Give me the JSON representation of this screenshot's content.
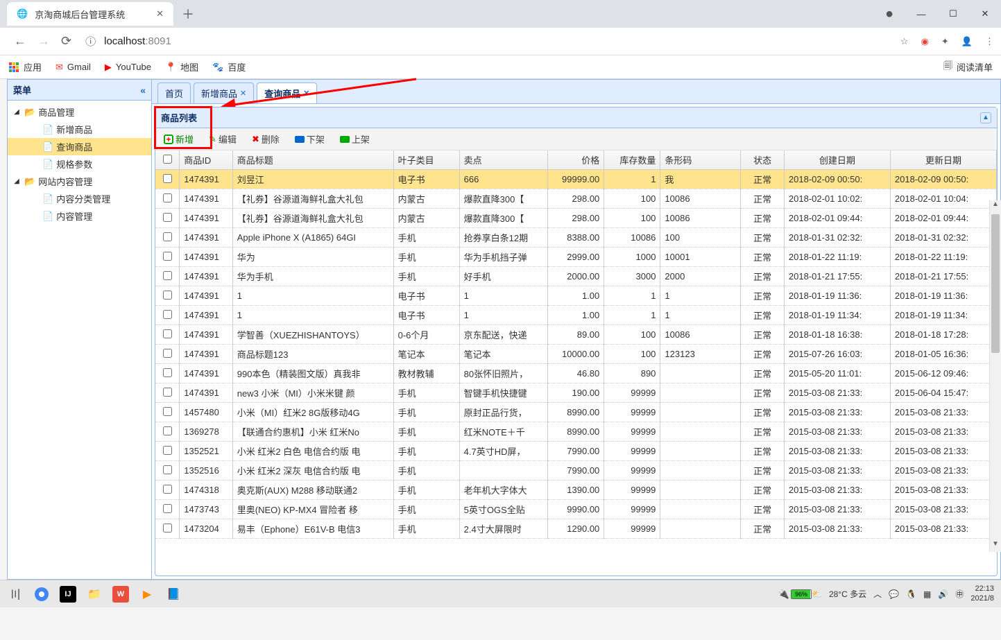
{
  "browser": {
    "tab_title": "京淘商城后台管理系统",
    "url_host": "localhost",
    "url_port": ":8091"
  },
  "bookmarks": {
    "apps": "应用",
    "gmail": "Gmail",
    "youtube": "YouTube",
    "maps": "地图",
    "baidu": "百度",
    "reading_list": "阅读清单"
  },
  "sidebar": {
    "title": "菜单",
    "items": [
      {
        "label": "商品管理",
        "type": "folder",
        "expanded": true
      },
      {
        "label": "新增商品",
        "type": "page"
      },
      {
        "label": "查询商品",
        "type": "page",
        "selected": true
      },
      {
        "label": "规格参数",
        "type": "page"
      },
      {
        "label": "网站内容管理",
        "type": "folder",
        "expanded": true
      },
      {
        "label": "内容分类管理",
        "type": "page"
      },
      {
        "label": "内容管理",
        "type": "page"
      }
    ]
  },
  "tabs": [
    {
      "label": "首页",
      "closable": false
    },
    {
      "label": "新增商品",
      "closable": true
    },
    {
      "label": "查询商品",
      "closable": true,
      "active": true
    }
  ],
  "panel": {
    "title": "商品列表"
  },
  "toolbar": {
    "add": "新增",
    "edit": "编辑",
    "delete": "删除",
    "down": "下架",
    "up": "上架"
  },
  "columns": {
    "id": "商品ID",
    "title": "商品标题",
    "category": "叶子类目",
    "sellpoint": "卖点",
    "price": "价格",
    "stock": "库存数量",
    "barcode": "条形码",
    "status": "状态",
    "created": "创建日期",
    "updated": "更新日期"
  },
  "rows": [
    {
      "id": "1474391",
      "title": "刘昱江",
      "category": "电子书",
      "sellpoint": "666",
      "price": "99999.00",
      "stock": "1",
      "barcode": "我",
      "status": "正常",
      "created": "2018-02-09 00:50:",
      "updated": "2018-02-09 00:50:",
      "selected": true
    },
    {
      "id": "1474391",
      "title": "【礼券】谷源道海鲜礼盒大礼包",
      "category": "内蒙古",
      "sellpoint": "爆款直降300【",
      "price": "298.00",
      "stock": "100",
      "barcode": "10086",
      "status": "正常",
      "created": "2018-02-01 10:02:",
      "updated": "2018-02-01 10:04:"
    },
    {
      "id": "1474391",
      "title": "【礼券】谷源道海鲜礼盒大礼包",
      "category": "内蒙古",
      "sellpoint": "爆款直降300【",
      "price": "298.00",
      "stock": "100",
      "barcode": "10086",
      "status": "正常",
      "created": "2018-02-01 09:44:",
      "updated": "2018-02-01 09:44:"
    },
    {
      "id": "1474391",
      "title": "Apple iPhone X (A1865) 64GI",
      "category": "手机",
      "sellpoint": "抢券享白条12期",
      "price": "8388.00",
      "stock": "10086",
      "barcode": "100",
      "status": "正常",
      "created": "2018-01-31 02:32:",
      "updated": "2018-01-31 02:32:"
    },
    {
      "id": "1474391",
      "title": "华为",
      "category": "手机",
      "sellpoint": "华为手机挡子弹",
      "price": "2999.00",
      "stock": "1000",
      "barcode": "10001",
      "status": "正常",
      "created": "2018-01-22 11:19:",
      "updated": "2018-01-22 11:19:"
    },
    {
      "id": "1474391",
      "title": "华为手机",
      "category": "手机",
      "sellpoint": "好手机",
      "price": "2000.00",
      "stock": "3000",
      "barcode": "2000",
      "status": "正常",
      "created": "2018-01-21 17:55:",
      "updated": "2018-01-21 17:55:"
    },
    {
      "id": "1474391",
      "title": "1",
      "category": "电子书",
      "sellpoint": "1",
      "price": "1.00",
      "stock": "1",
      "barcode": "1",
      "status": "正常",
      "created": "2018-01-19 11:36:",
      "updated": "2018-01-19 11:36:"
    },
    {
      "id": "1474391",
      "title": "1",
      "category": "电子书",
      "sellpoint": "1",
      "price": "1.00",
      "stock": "1",
      "barcode": "1",
      "status": "正常",
      "created": "2018-01-19 11:34:",
      "updated": "2018-01-19 11:34:"
    },
    {
      "id": "1474391",
      "title": "学智善（XUEZHISHANTOYS）",
      "category": "0-6个月",
      "sellpoint": "京东配送，快递",
      "price": "89.00",
      "stock": "100",
      "barcode": "10086",
      "status": "正常",
      "created": "2018-01-18 16:38:",
      "updated": "2018-01-18 17:28:"
    },
    {
      "id": "1474391",
      "title": "商品标题123",
      "category": "笔记本",
      "sellpoint": "笔记本",
      "price": "10000.00",
      "stock": "100",
      "barcode": "123123",
      "status": "正常",
      "created": "2015-07-26 16:03:",
      "updated": "2018-01-05 16:36:"
    },
    {
      "id": "1474391",
      "title": "990本色（精装图文版）真我非",
      "category": "教材教辅",
      "sellpoint": "80张怀旧照片，",
      "price": "46.80",
      "stock": "890",
      "barcode": "",
      "status": "正常",
      "created": "2015-05-20 11:01:",
      "updated": "2015-06-12 09:46:"
    },
    {
      "id": "1474391",
      "title": "new3 小米（MI）小米米键 颜",
      "category": "手机",
      "sellpoint": "智键手机快捷键",
      "price": "190.00",
      "stock": "99999",
      "barcode": "",
      "status": "正常",
      "created": "2015-03-08 21:33:",
      "updated": "2015-06-04 15:47:"
    },
    {
      "id": "1457480",
      "title": "小米（MI）红米2 8G版移动4G",
      "category": "手机",
      "sellpoint": "原封正品行货，",
      "price": "8990.00",
      "stock": "99999",
      "barcode": "",
      "status": "正常",
      "created": "2015-03-08 21:33:",
      "updated": "2015-03-08 21:33:"
    },
    {
      "id": "1369278",
      "title": "【联通合约惠机】小米 红米No",
      "category": "手机",
      "sellpoint": "红米NOTE＋千",
      "price": "8990.00",
      "stock": "99999",
      "barcode": "",
      "status": "正常",
      "created": "2015-03-08 21:33:",
      "updated": "2015-03-08 21:33:"
    },
    {
      "id": "1352521",
      "title": "小米 红米2 白色 电信合约版 电",
      "category": "手机",
      "sellpoint": "4.7英寸HD屏，",
      "price": "7990.00",
      "stock": "99999",
      "barcode": "",
      "status": "正常",
      "created": "2015-03-08 21:33:",
      "updated": "2015-03-08 21:33:"
    },
    {
      "id": "1352516",
      "title": "小米 红米2 深灰 电信合约版 电",
      "category": "手机",
      "sellpoint": "",
      "price": "7990.00",
      "stock": "99999",
      "barcode": "",
      "status": "正常",
      "created": "2015-03-08 21:33:",
      "updated": "2015-03-08 21:33:"
    },
    {
      "id": "1474318",
      "title": "奥克斯(AUX) M288 移动联通2",
      "category": "手机",
      "sellpoint": "老年机大字体大",
      "price": "1390.00",
      "stock": "99999",
      "barcode": "",
      "status": "正常",
      "created": "2015-03-08 21:33:",
      "updated": "2015-03-08 21:33:"
    },
    {
      "id": "1473743",
      "title": "里奥(NEO) KP-MX4 冒险者 移",
      "category": "手机",
      "sellpoint": "5英寸OGS全贴",
      "price": "9990.00",
      "stock": "99999",
      "barcode": "",
      "status": "正常",
      "created": "2015-03-08 21:33:",
      "updated": "2015-03-08 21:33:"
    },
    {
      "id": "1473204",
      "title": "易丰（Ephone）E61V-B 电信3",
      "category": "手机",
      "sellpoint": "2.4寸大屏限时",
      "price": "1290.00",
      "stock": "99999",
      "barcode": "",
      "status": "正常",
      "created": "2015-03-08 21:33:",
      "updated": "2015-03-08 21:33:"
    }
  ],
  "taskbar": {
    "battery": "96%",
    "weather": "28°C 多云",
    "time": "22:13",
    "date": "2021/8"
  }
}
